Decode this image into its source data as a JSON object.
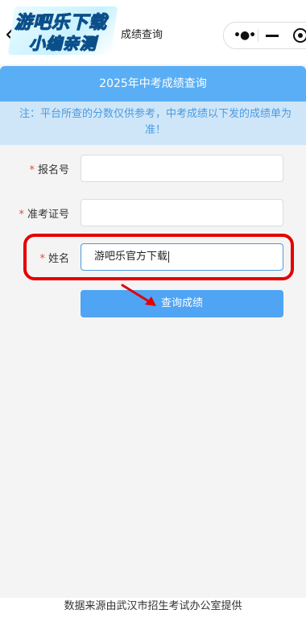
{
  "header": {
    "logo_line1": "游吧乐下载",
    "logo_line2": "小编亲测",
    "title": "成绩查询"
  },
  "banner": {
    "title": "2025年中考成绩查询"
  },
  "notice": {
    "text": "注：平台所查的分数仅供参考，中考成绩以下发的成绩单为准！"
  },
  "form": {
    "fields": [
      {
        "required_mark": "*",
        "label": "报名号",
        "value": ""
      },
      {
        "required_mark": "*",
        "label": "准考证号",
        "value": ""
      },
      {
        "required_mark": "*",
        "label": "姓名",
        "value": "游吧乐官方下载"
      }
    ],
    "submit_label": "查询成绩"
  },
  "footer": {
    "text": "数据来源由武汉市招生考试办公室提供"
  },
  "colors": {
    "accent": "#4fa4f4",
    "notice_bg": "#cfe6f9",
    "highlight": "#e40000"
  },
  "icons": [
    "back-chevron-icon",
    "more-dots-icon",
    "minimize-icon",
    "close-target-icon",
    "red-arrow-annotation"
  ]
}
